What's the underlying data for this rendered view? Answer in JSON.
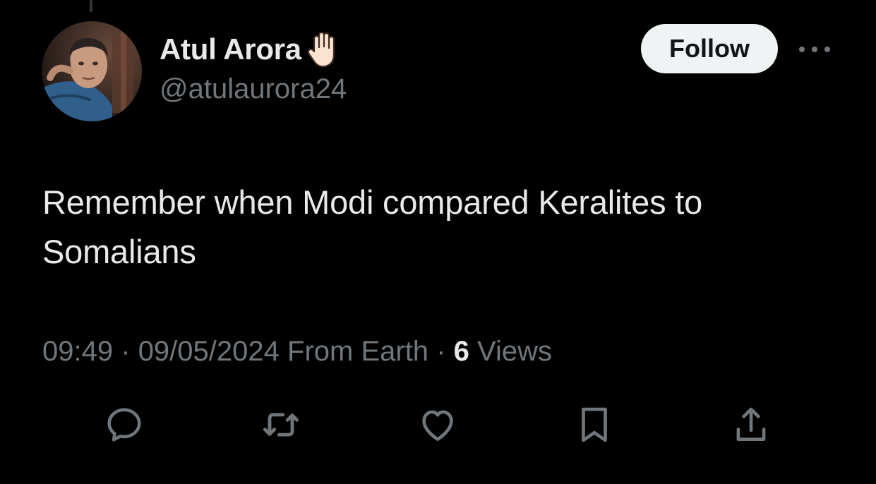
{
  "author": {
    "display_name": "Atul Arora",
    "emoji_icon": "raised-hand-emoji",
    "handle": "@atulaurora24"
  },
  "follow_label": "Follow",
  "more_icon": "ellipsis-icon",
  "tweet": {
    "text": "Remember when Modi compared Keralites to Somalians"
  },
  "meta": {
    "time": "09:49",
    "separator": "·",
    "date": "09/05/2024",
    "source": "From Earth",
    "views_count": "6",
    "views_label": "Views"
  },
  "actions": [
    {
      "icon": "reply-icon"
    },
    {
      "icon": "retweet-icon"
    },
    {
      "icon": "like-icon"
    },
    {
      "icon": "bookmark-icon"
    },
    {
      "icon": "share-icon"
    }
  ],
  "colors": {
    "background": "#000000",
    "text_primary": "#e7e9ea",
    "text_secondary": "#71767b",
    "follow_bg": "#eff3f4",
    "follow_text": "#0f1419"
  }
}
